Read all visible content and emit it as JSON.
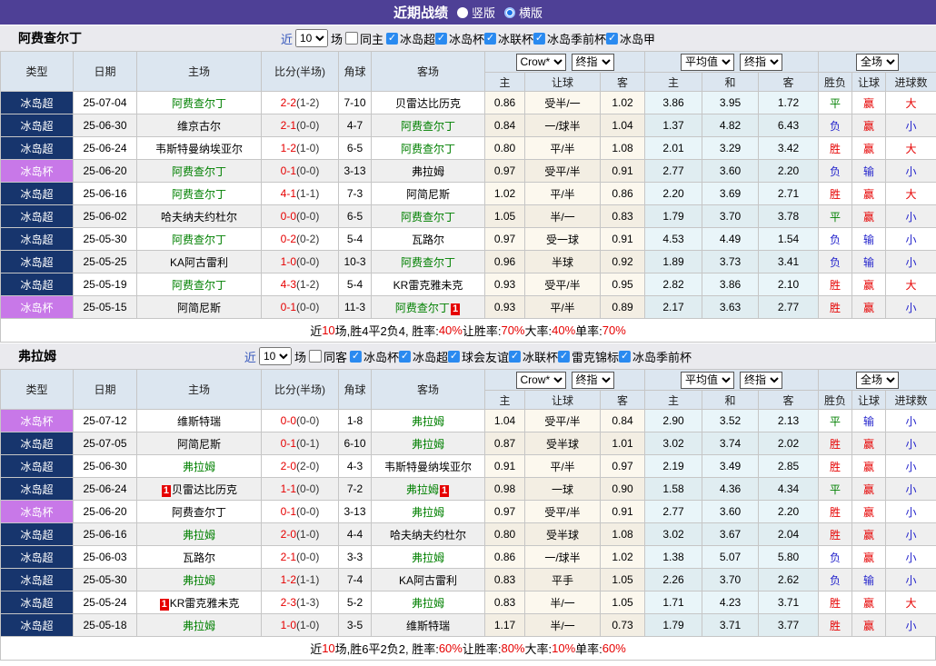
{
  "title_bar": {
    "title": "近期战绩",
    "radio_vertical": "竖版",
    "radio_horizontal": "横版",
    "selected_layout": "横版"
  },
  "filter_common": {
    "near": "近",
    "rounds": "10",
    "games": "场"
  },
  "table_header": {
    "main": [
      "类型",
      "日期",
      "主场",
      "比分(半场)",
      "角球",
      "客场"
    ],
    "sub": [
      "主",
      "让球",
      "客",
      "主",
      "和",
      "客",
      "胜负",
      "让球",
      "进球数"
    ],
    "selects": {
      "odds_provider": "Crow*",
      "odds_stage": "终指",
      "avg": "平均值",
      "avg_stage": "终指",
      "scope": "全场"
    }
  },
  "colors": {
    "accent_purple": "#4e4096",
    "league_super_bg": "#17356d",
    "league_cup_bg": "#c878e8",
    "focus_team_green": "#008000",
    "score_red": "#e60000",
    "win_red": "#e60000",
    "draw_green": "#008000",
    "lose_blue": "#2323cc",
    "odds_col_bg": "#fcf8ee",
    "avg_col_bg": "#e9f5f9",
    "checkbox_blue": "#2a8af0"
  },
  "sections": [
    {
      "team": "阿费查尔丁",
      "filter": {
        "same_venue": "同主",
        "same_checked": false,
        "leagues": [
          "冰岛超",
          "冰岛杯",
          "冰联杯",
          "冰岛季前杯",
          "冰岛甲"
        ]
      },
      "rows": [
        {
          "league": "冰岛超",
          "cup": false,
          "date": "25-07-04",
          "home": "阿费查尔丁",
          "home_focus": true,
          "home_badge": "",
          "score": "2-2",
          "half": "(1-2)",
          "corners": "7-10",
          "away": "贝雷达比历克",
          "away_focus": false,
          "away_badge": "",
          "odds": [
            "0.86",
            "受半/一",
            "1.02"
          ],
          "avgs": [
            "3.86",
            "3.95",
            "1.72"
          ],
          "results": [
            "平",
            "赢",
            "大"
          ]
        },
        {
          "league": "冰岛超",
          "cup": false,
          "date": "25-06-30",
          "home": "维京古尔",
          "home_focus": false,
          "home_badge": "",
          "score": "2-1",
          "half": "(0-0)",
          "corners": "4-7",
          "away": "阿费查尔丁",
          "away_focus": true,
          "away_badge": "",
          "odds": [
            "0.84",
            "一/球半",
            "1.04"
          ],
          "avgs": [
            "1.37",
            "4.82",
            "6.43"
          ],
          "results": [
            "负",
            "赢",
            "小"
          ]
        },
        {
          "league": "冰岛超",
          "cup": false,
          "date": "25-06-24",
          "home": "韦斯特曼纳埃亚尔",
          "home_focus": false,
          "home_badge": "",
          "score": "1-2",
          "half": "(1-0)",
          "corners": "6-5",
          "away": "阿费查尔丁",
          "away_focus": true,
          "away_badge": "",
          "odds": [
            "0.80",
            "平/半",
            "1.08"
          ],
          "avgs": [
            "2.01",
            "3.29",
            "3.42"
          ],
          "results": [
            "胜",
            "赢",
            "大"
          ]
        },
        {
          "league": "冰岛杯",
          "cup": true,
          "date": "25-06-20",
          "home": "阿费查尔丁",
          "home_focus": true,
          "home_badge": "",
          "score": "0-1",
          "half": "(0-0)",
          "corners": "3-13",
          "away": "弗拉姆",
          "away_focus": false,
          "away_badge": "",
          "odds": [
            "0.97",
            "受平/半",
            "0.91"
          ],
          "avgs": [
            "2.77",
            "3.60",
            "2.20"
          ],
          "results": [
            "负",
            "输",
            "小"
          ]
        },
        {
          "league": "冰岛超",
          "cup": false,
          "date": "25-06-16",
          "home": "阿费查尔丁",
          "home_focus": true,
          "home_badge": "",
          "score": "4-1",
          "half": "(1-1)",
          "corners": "7-3",
          "away": "阿简尼斯",
          "away_focus": false,
          "away_badge": "",
          "odds": [
            "1.02",
            "平/半",
            "0.86"
          ],
          "avgs": [
            "2.20",
            "3.69",
            "2.71"
          ],
          "results": [
            "胜",
            "赢",
            "大"
          ]
        },
        {
          "league": "冰岛超",
          "cup": false,
          "date": "25-06-02",
          "home": "哈夫纳夫约杜尔",
          "home_focus": false,
          "home_badge": "",
          "score": "0-0",
          "half": "(0-0)",
          "corners": "6-5",
          "away": "阿费查尔丁",
          "away_focus": true,
          "away_badge": "",
          "odds": [
            "1.05",
            "半/一",
            "0.83"
          ],
          "avgs": [
            "1.79",
            "3.70",
            "3.78"
          ],
          "results": [
            "平",
            "赢",
            "小"
          ]
        },
        {
          "league": "冰岛超",
          "cup": false,
          "date": "25-05-30",
          "home": "阿费查尔丁",
          "home_focus": true,
          "home_badge": "",
          "score": "0-2",
          "half": "(0-2)",
          "corners": "5-4",
          "away": "瓦路尔",
          "away_focus": false,
          "away_badge": "",
          "odds": [
            "0.97",
            "受一球",
            "0.91"
          ],
          "avgs": [
            "4.53",
            "4.49",
            "1.54"
          ],
          "results": [
            "负",
            "输",
            "小"
          ]
        },
        {
          "league": "冰岛超",
          "cup": false,
          "date": "25-05-25",
          "home": "KA阿古雷利",
          "home_focus": false,
          "home_badge": "",
          "score": "1-0",
          "half": "(0-0)",
          "corners": "10-3",
          "away": "阿费查尔丁",
          "away_focus": true,
          "away_badge": "",
          "odds": [
            "0.96",
            "半球",
            "0.92"
          ],
          "avgs": [
            "1.89",
            "3.73",
            "3.41"
          ],
          "results": [
            "负",
            "输",
            "小"
          ]
        },
        {
          "league": "冰岛超",
          "cup": false,
          "date": "25-05-19",
          "home": "阿费查尔丁",
          "home_focus": true,
          "home_badge": "",
          "score": "4-3",
          "half": "(1-2)",
          "corners": "5-4",
          "away": "KR雷克雅未克",
          "away_focus": false,
          "away_badge": "",
          "odds": [
            "0.93",
            "受平/半",
            "0.95"
          ],
          "avgs": [
            "2.82",
            "3.86",
            "2.10"
          ],
          "results": [
            "胜",
            "赢",
            "大"
          ]
        },
        {
          "league": "冰岛杯",
          "cup": true,
          "date": "25-05-15",
          "home": "阿简尼斯",
          "home_focus": false,
          "home_badge": "",
          "score": "0-1",
          "half": "(0-0)",
          "corners": "11-3",
          "away": "阿费查尔丁",
          "away_focus": true,
          "away_badge": "1",
          "odds": [
            "0.93",
            "平/半",
            "0.89"
          ],
          "avgs": [
            "2.17",
            "3.63",
            "2.77"
          ],
          "results": [
            "胜",
            "赢",
            "小"
          ]
        }
      ],
      "summary": [
        [
          "近",
          0
        ],
        [
          "10",
          1
        ],
        [
          "场,胜4平2负4, 胜率:",
          0
        ],
        [
          "40%",
          1
        ],
        [
          " 让胜率:",
          0
        ],
        [
          "70%",
          1
        ],
        [
          " 大率:",
          0
        ],
        [
          "40%",
          1
        ],
        [
          " 单率:",
          0
        ],
        [
          "70%",
          1
        ]
      ]
    },
    {
      "team": "弗拉姆",
      "filter": {
        "same_venue": "同客",
        "same_checked": false,
        "leagues": [
          "冰岛杯",
          "冰岛超",
          "球会友谊",
          "冰联杯",
          "雷克锦标",
          "冰岛季前杯"
        ]
      },
      "rows": [
        {
          "league": "冰岛杯",
          "cup": true,
          "date": "25-07-12",
          "home": "维斯特瑞",
          "home_focus": false,
          "home_badge": "",
          "score": "0-0",
          "half": "(0-0)",
          "corners": "1-8",
          "away": "弗拉姆",
          "away_focus": true,
          "away_badge": "",
          "odds": [
            "1.04",
            "受平/半",
            "0.84"
          ],
          "avgs": [
            "2.90",
            "3.52",
            "2.13"
          ],
          "results": [
            "平",
            "输",
            "小"
          ]
        },
        {
          "league": "冰岛超",
          "cup": false,
          "date": "25-07-05",
          "home": "阿简尼斯",
          "home_focus": false,
          "home_badge": "",
          "score": "0-1",
          "half": "(0-1)",
          "corners": "6-10",
          "away": "弗拉姆",
          "away_focus": true,
          "away_badge": "",
          "odds": [
            "0.87",
            "受半球",
            "1.01"
          ],
          "avgs": [
            "3.02",
            "3.74",
            "2.02"
          ],
          "results": [
            "胜",
            "赢",
            "小"
          ]
        },
        {
          "league": "冰岛超",
          "cup": false,
          "date": "25-06-30",
          "home": "弗拉姆",
          "home_focus": true,
          "home_badge": "",
          "score": "2-0",
          "half": "(2-0)",
          "corners": "4-3",
          "away": "韦斯特曼纳埃亚尔",
          "away_focus": false,
          "away_badge": "",
          "odds": [
            "0.91",
            "平/半",
            "0.97"
          ],
          "avgs": [
            "2.19",
            "3.49",
            "2.85"
          ],
          "results": [
            "胜",
            "赢",
            "小"
          ]
        },
        {
          "league": "冰岛超",
          "cup": false,
          "date": "25-06-24",
          "home": "贝雷达比历克",
          "home_focus": false,
          "home_badge": "1",
          "score": "1-1",
          "half": "(0-0)",
          "corners": "7-2",
          "away": "弗拉姆",
          "away_focus": true,
          "away_badge": "1",
          "odds": [
            "0.98",
            "一球",
            "0.90"
          ],
          "avgs": [
            "1.58",
            "4.36",
            "4.34"
          ],
          "results": [
            "平",
            "赢",
            "小"
          ]
        },
        {
          "league": "冰岛杯",
          "cup": true,
          "date": "25-06-20",
          "home": "阿费查尔丁",
          "home_focus": false,
          "home_badge": "",
          "score": "0-1",
          "half": "(0-0)",
          "corners": "3-13",
          "away": "弗拉姆",
          "away_focus": true,
          "away_badge": "",
          "odds": [
            "0.97",
            "受平/半",
            "0.91"
          ],
          "avgs": [
            "2.77",
            "3.60",
            "2.20"
          ],
          "results": [
            "胜",
            "赢",
            "小"
          ]
        },
        {
          "league": "冰岛超",
          "cup": false,
          "date": "25-06-16",
          "home": "弗拉姆",
          "home_focus": true,
          "home_badge": "",
          "score": "2-0",
          "half": "(1-0)",
          "corners": "4-4",
          "away": "哈夫纳夫约杜尔",
          "away_focus": false,
          "away_badge": "",
          "odds": [
            "0.80",
            "受半球",
            "1.08"
          ],
          "avgs": [
            "3.02",
            "3.67",
            "2.04"
          ],
          "results": [
            "胜",
            "赢",
            "小"
          ]
        },
        {
          "league": "冰岛超",
          "cup": false,
          "date": "25-06-03",
          "home": "瓦路尔",
          "home_focus": false,
          "home_badge": "",
          "score": "2-1",
          "half": "(0-0)",
          "corners": "3-3",
          "away": "弗拉姆",
          "away_focus": true,
          "away_badge": "",
          "odds": [
            "0.86",
            "一/球半",
            "1.02"
          ],
          "avgs": [
            "1.38",
            "5.07",
            "5.80"
          ],
          "results": [
            "负",
            "赢",
            "小"
          ]
        },
        {
          "league": "冰岛超",
          "cup": false,
          "date": "25-05-30",
          "home": "弗拉姆",
          "home_focus": true,
          "home_badge": "",
          "score": "1-2",
          "half": "(1-1)",
          "corners": "7-4",
          "away": "KA阿古雷利",
          "away_focus": false,
          "away_badge": "",
          "odds": [
            "0.83",
            "平手",
            "1.05"
          ],
          "avgs": [
            "2.26",
            "3.70",
            "2.62"
          ],
          "results": [
            "负",
            "输",
            "小"
          ]
        },
        {
          "league": "冰岛超",
          "cup": false,
          "date": "25-05-24",
          "home": "KR雷克雅未克",
          "home_focus": false,
          "home_badge": "1",
          "score": "2-3",
          "half": "(1-3)",
          "corners": "5-2",
          "away": "弗拉姆",
          "away_focus": true,
          "away_badge": "",
          "odds": [
            "0.83",
            "半/一",
            "1.05"
          ],
          "avgs": [
            "1.71",
            "4.23",
            "3.71"
          ],
          "results": [
            "胜",
            "赢",
            "大"
          ]
        },
        {
          "league": "冰岛超",
          "cup": false,
          "date": "25-05-18",
          "home": "弗拉姆",
          "home_focus": true,
          "home_badge": "",
          "score": "1-0",
          "half": "(1-0)",
          "corners": "3-5",
          "away": "维斯特瑞",
          "away_focus": false,
          "away_badge": "",
          "odds": [
            "1.17",
            "半/一",
            "0.73"
          ],
          "avgs": [
            "1.79",
            "3.71",
            "3.77"
          ],
          "results": [
            "胜",
            "赢",
            "小"
          ]
        }
      ],
      "summary": [
        [
          "近",
          0
        ],
        [
          "10",
          1
        ],
        [
          "场,胜6平2负2, 胜率:",
          0
        ],
        [
          "60%",
          1
        ],
        [
          " 让胜率:",
          0
        ],
        [
          "80%",
          1
        ],
        [
          " 大率:",
          0
        ],
        [
          "10%",
          1
        ],
        [
          " 单率:",
          0
        ],
        [
          "60%",
          1
        ]
      ]
    }
  ]
}
